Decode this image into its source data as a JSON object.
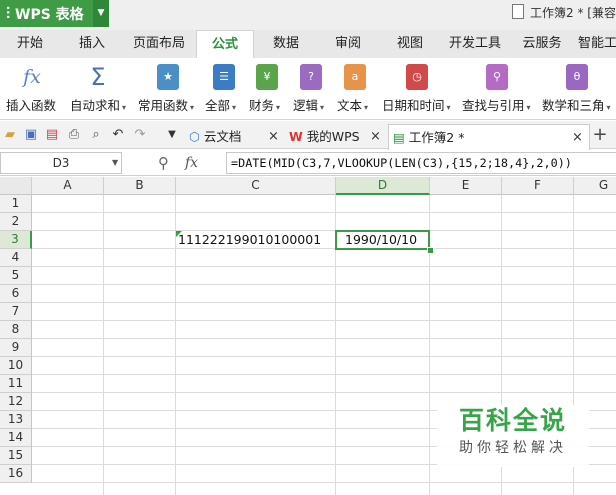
{
  "app": {
    "name": "WPS 表格",
    "doc_title": "工作簿2 * [兼容"
  },
  "ribbon_tabs": [
    "开始",
    "插入",
    "页面布局",
    "公式",
    "数据",
    "审阅",
    "视图",
    "开发工具",
    "云服务",
    "智能工"
  ],
  "active_tab": "公式",
  "ribbon_buttons": [
    {
      "label": "插入函数",
      "icon": "fx-icon",
      "glyph": "fx",
      "color": "#5b7fc7"
    },
    {
      "label": "自动求和",
      "icon": "sigma-icon",
      "glyph": "Σ",
      "color": "#4a6fb8",
      "arrow": "▾"
    },
    {
      "label": "常用函数",
      "icon": "star-function-icon",
      "glyph": "★",
      "color": "#4a8fc8",
      "arrow": "▾"
    },
    {
      "label": "全部",
      "icon": "list-function-icon",
      "glyph": "☰",
      "color": "#3c7cc4",
      "arrow": "▾"
    },
    {
      "label": "财务",
      "icon": "finance-icon",
      "glyph": "¥",
      "color": "#5aa54b",
      "arrow": "▾"
    },
    {
      "label": "逻辑",
      "icon": "logic-icon",
      "glyph": "?",
      "color": "#9a6bc1",
      "arrow": "▾"
    },
    {
      "label": "文本",
      "icon": "text-function-icon",
      "glyph": "a",
      "color": "#e8934a",
      "arrow": "▾"
    },
    {
      "label": "日期和时间",
      "icon": "clock-icon",
      "glyph": "◷",
      "color": "#d14a4a",
      "arrow": "▾"
    },
    {
      "label": "查找与引用",
      "icon": "lookup-icon",
      "glyph": "⚲",
      "color": "#b46bc4",
      "arrow": "▾"
    },
    {
      "label": "数学和三角",
      "icon": "math-icon",
      "glyph": "θ",
      "color": "#9a68c0",
      "arrow": "▾"
    }
  ],
  "doc_tabs": [
    {
      "label": "云文档",
      "icon": "cloud-doc-icon",
      "close": "×"
    },
    {
      "label": "我的WPS",
      "icon": "wps-logo-icon",
      "close": "×"
    },
    {
      "label": "工作簿2 *",
      "icon": "sheet-doc-icon",
      "close": "×",
      "active": true
    }
  ],
  "new_tab": "+",
  "formula_bar": {
    "name_box": "D3",
    "fx": "fx",
    "formula": "=DATE(MID(C3,7,VLOOKUP(LEN(C3),{15,2;18,4},2,0))"
  },
  "columns": [
    "A",
    "B",
    "C",
    "D",
    "E",
    "F",
    "G"
  ],
  "selected_column": "D",
  "rows": [
    "1",
    "2",
    "3",
    "4",
    "5",
    "6",
    "7",
    "8",
    "9",
    "10",
    "11",
    "12",
    "13",
    "14",
    "15",
    "16"
  ],
  "selected_row": "3",
  "cells": {
    "C3": "111222199010100001",
    "D3": "1990/10/10"
  },
  "watermark": {
    "title": "百科全说",
    "subtitle": "助你轻松解决"
  },
  "colors": {
    "accent": "#3b9a45",
    "ribbon_active": "#2e8f3a"
  }
}
